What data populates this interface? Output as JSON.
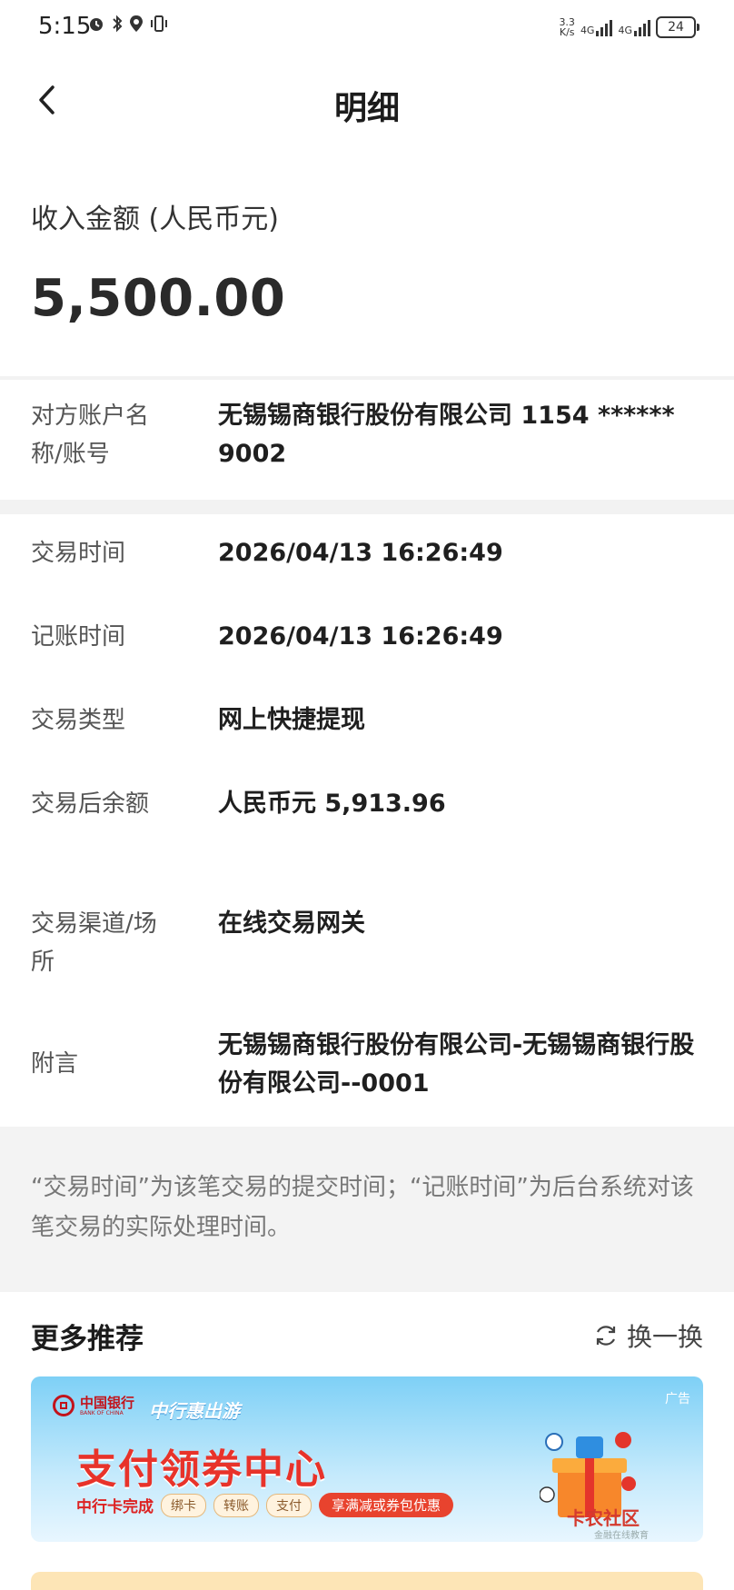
{
  "status_bar": {
    "time": "5:15",
    "speed_top": "3.3",
    "speed_bottom": "K/s",
    "net1": "4G",
    "net2": "4G",
    "battery": "24"
  },
  "header": {
    "title": "明细"
  },
  "amount": {
    "label": "收入金额 (人民币元)",
    "value": "5,500.00"
  },
  "details": [
    {
      "label": "对方账户名称/账号",
      "value": "无锡锡商银行股份有限公司 1154 ****** 9002"
    },
    {
      "label": "交易时间",
      "value": "2026/04/13 16:26:49"
    },
    {
      "label": "记账时间",
      "value": "2026/04/13 16:26:49"
    },
    {
      "label": "交易类型",
      "value": "网上快捷提现"
    },
    {
      "label": "交易后余额",
      "value": "人民币元 5,913.96"
    },
    {
      "label": "交易渠道/场所",
      "value": "在线交易网关"
    },
    {
      "label": "附言",
      "value": "无锡锡商银行股份有限公司-无锡锡商银行股份有限公司--0001"
    }
  ],
  "note": "“交易时间”为该笔交易的提交时间；“记账时间”为后台系统对该笔交易的实际处理时间。",
  "recommend": {
    "title": "更多推荐",
    "refresh_label": "换一换"
  },
  "banner": {
    "ad_tag": "广告",
    "bank_name": "中国银行",
    "bank_en": "BANK OF CHINA",
    "sub_brand": "中行惠出游",
    "title": "支付领券中心",
    "lead": "中行卡完成",
    "chips": [
      "绑卡",
      "转账",
      "支付"
    ],
    "highlight": "享满减或券包优惠",
    "watermark": "卡农社区",
    "watermark_sub": "金融在线教育"
  }
}
